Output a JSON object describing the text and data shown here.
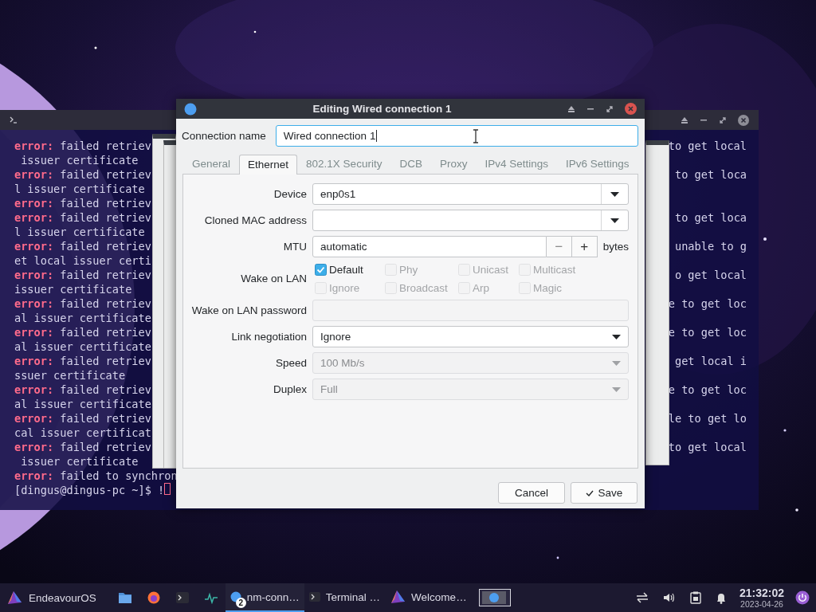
{
  "terminal": {
    "lines": [
      {
        "kind": "error",
        "label": "error:",
        "text": "failed retriev",
        "right": "to get local"
      },
      {
        "kind": "plain",
        "text": " issuer certificate"
      },
      {
        "kind": "error",
        "label": "error:",
        "text": "failed retriev",
        "right": "to get loca"
      },
      {
        "kind": "plain",
        "text": "l issuer certificate"
      },
      {
        "kind": "error",
        "label": "error:",
        "text": "failed retriev"
      },
      {
        "kind": "error",
        "label": "error:",
        "text": "failed retriev",
        "right": "to get loca"
      },
      {
        "kind": "plain",
        "text": "l issuer certificate"
      },
      {
        "kind": "error",
        "label": "error:",
        "text": "failed retriev",
        "right": "unable to g"
      },
      {
        "kind": "plain",
        "text": "et local issuer certi"
      },
      {
        "kind": "error",
        "label": "error:",
        "text": "failed retriev",
        "right": "o get local"
      },
      {
        "kind": "plain",
        "text": "issuer certificate"
      },
      {
        "kind": "error",
        "label": "error:",
        "text": "failed retriev",
        "right": "e to get loc"
      },
      {
        "kind": "plain",
        "text": "al issuer certificate"
      },
      {
        "kind": "error",
        "label": "error:",
        "text": "failed retriev",
        "right": "e to get loc"
      },
      {
        "kind": "plain",
        "text": "al issuer certificate"
      },
      {
        "kind": "error",
        "label": "error:",
        "text": "failed retriev",
        "right": "get local i"
      },
      {
        "kind": "plain",
        "text": "ssuer certificate"
      },
      {
        "kind": "error",
        "label": "error:",
        "text": "failed retriev",
        "right": "e to get loc"
      },
      {
        "kind": "plain",
        "text": "al issuer certificate"
      },
      {
        "kind": "error",
        "label": "error:",
        "text": "failed retriev",
        "right": "le to get lo"
      },
      {
        "kind": "plain",
        "text": "cal issuer certificat"
      },
      {
        "kind": "error",
        "label": "error:",
        "text": "failed retriev",
        "right": "to get local"
      },
      {
        "kind": "plain",
        "text": " issuer certificate"
      },
      {
        "kind": "error",
        "label": "error:",
        "text": "failed to synchron"
      },
      {
        "kind": "prompt",
        "text": "[dingus@dingus-pc ~]$ !"
      }
    ]
  },
  "dialog": {
    "title": "Editing Wired connection 1",
    "connection_name": {
      "label": "Connection name",
      "value": "Wired connection 1"
    },
    "tabs": [
      {
        "label": "General",
        "selected": false
      },
      {
        "label": "Ethernet",
        "selected": true
      },
      {
        "label": "802.1X Security",
        "selected": false
      },
      {
        "label": "DCB",
        "selected": false
      },
      {
        "label": "Proxy",
        "selected": false
      },
      {
        "label": "IPv4 Settings",
        "selected": false
      },
      {
        "label": "IPv6 Settings",
        "selected": false
      }
    ],
    "fields": [
      {
        "kind": "combo",
        "label": "Device",
        "value": "enp0s1"
      },
      {
        "kind": "combo",
        "label": "Cloned MAC address"
      },
      {
        "kind": "spin",
        "label": "MTU",
        "value": "automatic",
        "minus": "−",
        "plus": "+",
        "unit": "bytes"
      },
      {
        "kind": "checks",
        "label": "Wake on LAN",
        "options": [
          {
            "label": "Default",
            "checked": true,
            "disabled": false
          },
          {
            "label": "Phy",
            "checked": false,
            "disabled": true
          },
          {
            "label": "Unicast",
            "checked": false,
            "disabled": true
          },
          {
            "label": "Multicast",
            "checked": false,
            "disabled": true
          },
          {
            "label": "Ignore",
            "checked": false,
            "disabled": true
          },
          {
            "label": "Broadcast",
            "checked": false,
            "disabled": true
          },
          {
            "label": "Arp",
            "checked": false,
            "disabled": true
          },
          {
            "label": "Magic",
            "checked": false,
            "disabled": true
          }
        ]
      },
      {
        "kind": "entry",
        "label": "Wake on LAN password",
        "disabled": true
      },
      {
        "kind": "select",
        "label": "Link negotiation",
        "value": "Ignore",
        "disabled": false
      },
      {
        "kind": "select",
        "label": "Speed",
        "value": "100 Mb/s",
        "disabled": true
      },
      {
        "kind": "select",
        "label": "Duplex",
        "value": "Full",
        "disabled": true
      }
    ],
    "buttons": [
      {
        "label": "Cancel"
      },
      {
        "label": "Save"
      }
    ]
  },
  "taskbar": {
    "start": "EndeavourOS",
    "tasks": [
      {
        "label": "nm-conn…",
        "badge": "2",
        "selected": true
      },
      {
        "label": "Terminal …",
        "selected": false
      },
      {
        "label": "Welcome…",
        "selected": false
      }
    ],
    "clock": {
      "time": "21:32:02",
      "date": "2023-04-26"
    }
  }
}
